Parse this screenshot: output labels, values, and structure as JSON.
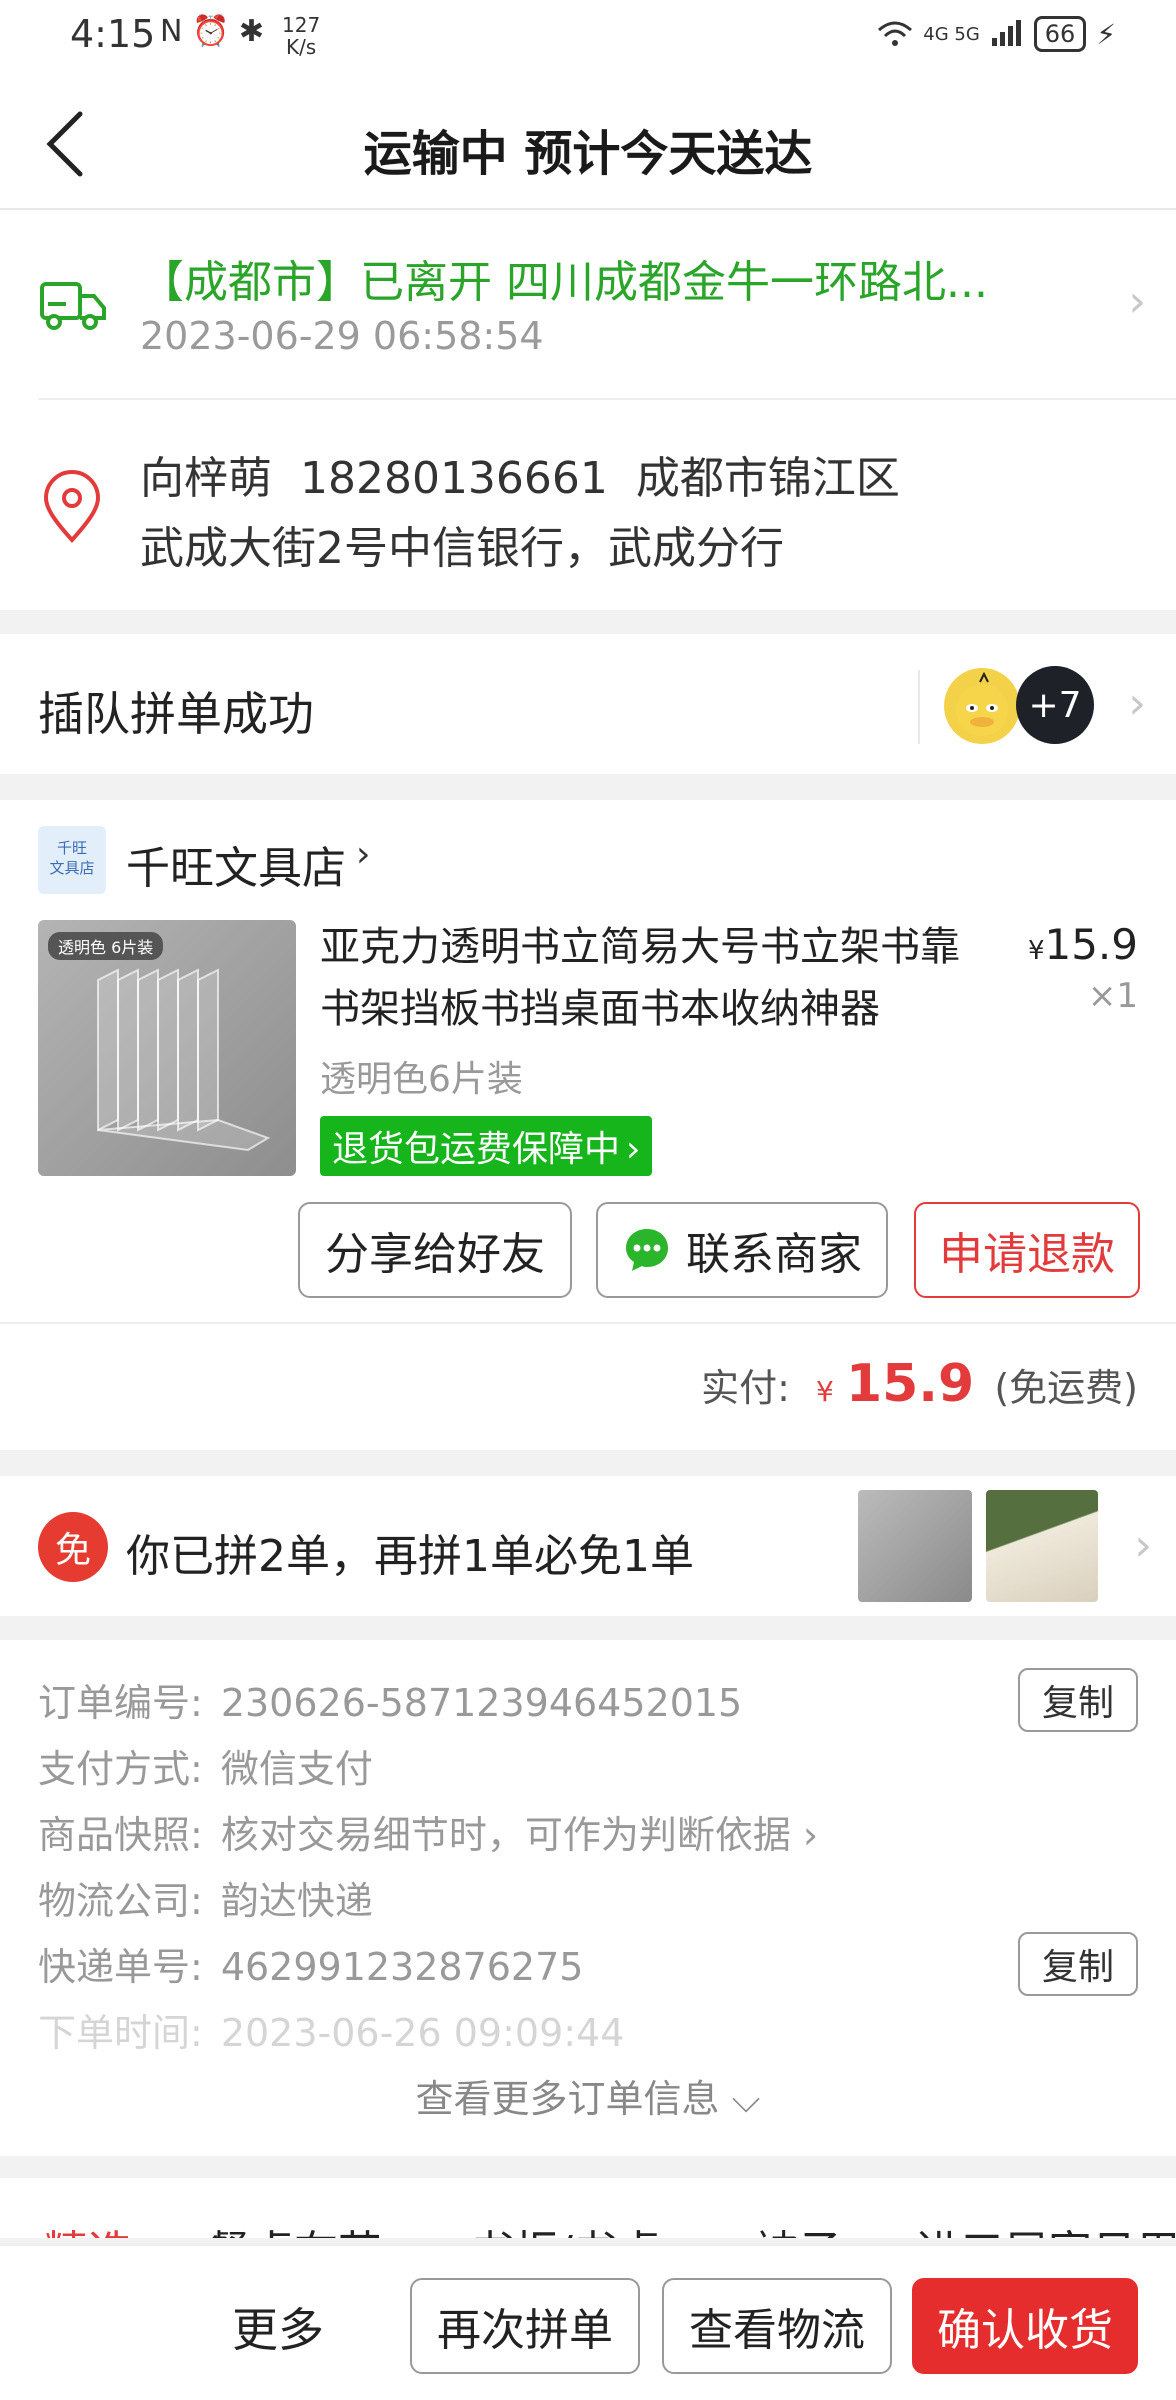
{
  "status_bar": {
    "time": "4:15",
    "left_icons": "N ⏰ ✱",
    "speed_value": "127",
    "speed_unit": "K/s",
    "network": "4G 5G",
    "battery": "66"
  },
  "nav": {
    "title": "运输中 预计今天送达"
  },
  "tracking": {
    "status": "【成都市】已离开 四川成都金牛一环路北...",
    "time": "2023-06-29 06:58:54"
  },
  "address": {
    "line1": "向梓萌  18280136661  成都市锦江区",
    "line2": "武成大街2号中信银行，武成分行"
  },
  "group": {
    "label": "插队拼单成功",
    "extra_count": "+7"
  },
  "shop": {
    "logo_text_1": "千旺",
    "logo_text_2": "文具店",
    "name": "千旺文具店"
  },
  "product": {
    "tag_text": "透明色  6片装",
    "name": "亚克力透明书立简易大号书立架书靠书架挡板书挡桌面书本收纳神器",
    "currency": "¥",
    "price": "15.9",
    "quantity": "×1",
    "spec": "透明色6片装",
    "guarantee": "退货包运费保障中",
    "guarantee_chevron": "›"
  },
  "actions": {
    "share": "分享给好友",
    "contact": "联系商家",
    "refund": "申请退款"
  },
  "payment": {
    "label": "实付:",
    "currency": "¥",
    "amount": "15.9",
    "note": "(免运费)"
  },
  "promo": {
    "badge": "免",
    "text": "你已拼2单，再拼1单必免1单"
  },
  "order_info": {
    "rows": [
      {
        "key": "订单编号:",
        "value": "230626-587123946452015"
      },
      {
        "key": "支付方式:",
        "value": "微信支付"
      },
      {
        "key": "商品快照:",
        "value": "核对交易细节时，可作为判断依据 ›"
      },
      {
        "key": "物流公司:",
        "value": "韵达快递"
      },
      {
        "key": "快递单号:",
        "value": "462991232876275"
      },
      {
        "key": "下单时间:",
        "value": "2023-06-26 09:09:44"
      }
    ],
    "copy_label": "复制",
    "more": "查看更多订单信息 ⌵"
  },
  "categories": [
    "精选",
    "餐桌布艺",
    "书柜/书桌",
    "被子",
    "进口居家日用"
  ],
  "bottom_bar": {
    "more": "更多",
    "again": "再次拼单",
    "logistics": "查看物流",
    "confirm": "确认收货"
  }
}
